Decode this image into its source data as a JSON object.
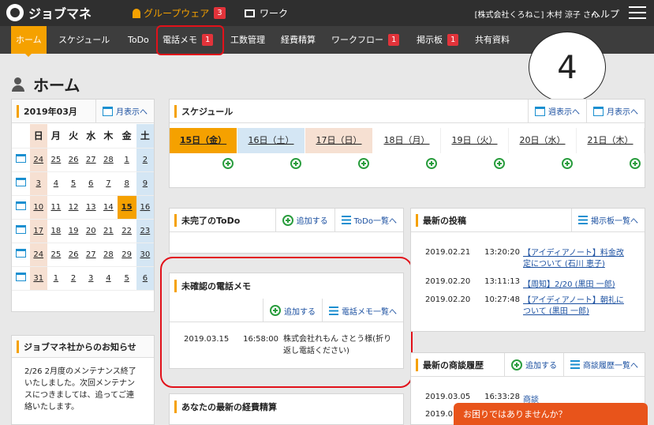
{
  "topbar": {
    "logo": "ジョブマネ",
    "groupware": "グループウェア",
    "groupware_badge": "3",
    "work": "ワーク",
    "user": "[株式会社くろねこ] 木村 涼子 さん",
    "help": "ヘルプ"
  },
  "nav": [
    "ホーム",
    "スケジュール",
    "ToDo",
    "電話メモ",
    "工数管理",
    "経費精算",
    "ワークフロー",
    "掲示板",
    "共有資料"
  ],
  "nav_badges": {
    "memo": "1",
    "workflow": "1",
    "board": "1"
  },
  "overlay_number": "4",
  "page_title": "ホーム",
  "calendar": {
    "month": "2019年03月",
    "month_view": "月表示へ",
    "days": [
      "日",
      "月",
      "火",
      "水",
      "木",
      "金",
      "土"
    ],
    "weeks": [
      [
        "24",
        "25",
        "26",
        "27",
        "28",
        "1",
        "2"
      ],
      [
        "3",
        "4",
        "5",
        "6",
        "7",
        "8",
        "9"
      ],
      [
        "10",
        "11",
        "12",
        "13",
        "14",
        "15",
        "16"
      ],
      [
        "17",
        "18",
        "19",
        "20",
        "21",
        "22",
        "23"
      ],
      [
        "24",
        "25",
        "26",
        "27",
        "28",
        "29",
        "30"
      ],
      [
        "31",
        "1",
        "2",
        "3",
        "4",
        "5",
        "6"
      ]
    ]
  },
  "notice": {
    "title": "ジョブマネ社からのお知らせ",
    "body": "2/26 2月度のメンテナンス終了いたしました。次回メンテナンスにつきましては、追ってご連絡いたします。"
  },
  "schedule": {
    "title": "スケジュール",
    "week_view": "週表示へ",
    "month_view": "月表示へ",
    "days": [
      "15日（金）",
      "16日（土）",
      "17日（日）",
      "18日（月）",
      "19日（火）",
      "20日（水）",
      "21日（木）"
    ]
  },
  "todo": {
    "title": "未完了のToDo",
    "add": "追加する",
    "list": "ToDo一覧へ"
  },
  "memo": {
    "title": "未確認の電話メモ",
    "add": "追加する",
    "list": "電話メモ一覧へ",
    "date": "2019.03.15",
    "time": "16:58:00",
    "text": "株式会社れもん さとう様(折り返し電話ください)"
  },
  "expense": {
    "title": "あなたの最新の経費精算"
  },
  "posts": {
    "title": "最新の投稿",
    "list": "掲示板一覧へ",
    "items": [
      {
        "date": "2019.02.21",
        "time": "13:20:20",
        "text": "【アイディアノート】料金改定について (石川 恵子)"
      },
      {
        "date": "2019.02.20",
        "time": "13:11:13",
        "text": "【周知】2/20 (黒田 一郎)"
      },
      {
        "date": "2019.02.20",
        "time": "10:27:48",
        "text": "【アイディアノート】朝礼について (黒田 一郎)"
      }
    ]
  },
  "deals": {
    "title": "最新の商談履歴",
    "add": "追加する",
    "list": "商談履歴一覧へ",
    "date1": "2019.03.05",
    "time1": "16:33:28",
    "text1": "商談",
    "date2": "2019.0"
  },
  "chat": "お困りではありませんか？"
}
